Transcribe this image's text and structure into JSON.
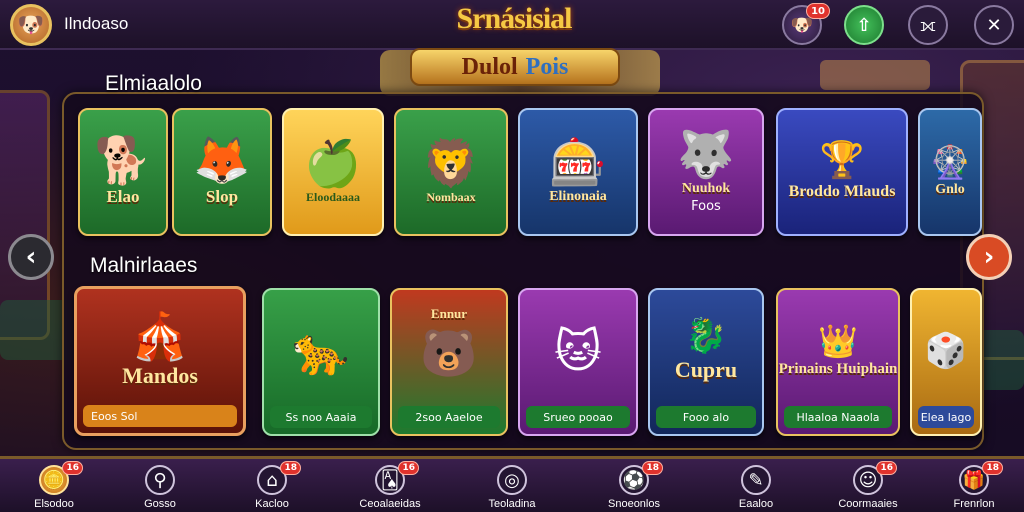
{
  "header": {
    "username": "Ilndoaso",
    "logo": "Srnásisial",
    "banner_left": "Dulol",
    "banner_right": "Pois",
    "profile_badge": "10",
    "colors": {
      "accent": "#f6c944",
      "badge": "#e0322d"
    }
  },
  "sections": [
    {
      "title": "Elmiaalolo",
      "games": [
        {
          "title": "Elao",
          "emblem": "🐕",
          "bg": "#2f8a3a"
        },
        {
          "title": "Slop",
          "emblem": "🦊",
          "bg": "#2e7d35"
        },
        {
          "title": "Eloodaaaa",
          "emblem": "🍏",
          "bg": "#f0b531"
        },
        {
          "title": "Nombaax",
          "emblem": "🦁",
          "bg": "#2b8a40"
        },
        {
          "title": "Elinonaia",
          "emblem": "🎰",
          "bg": "#1e4a86"
        },
        {
          "title": "Nuuhok",
          "emblem": "🐺",
          "bg": "#7a2a8a",
          "foot": "Foos"
        },
        {
          "title": "Broddo Mlauds",
          "emblem": "🏆",
          "bg": "#2a3a9a"
        },
        {
          "title": "Gnlo",
          "emblem": "🎡",
          "bg": "#28608a"
        }
      ]
    },
    {
      "title": "Malnirlaaes",
      "games": [
        {
          "title": "Mandos",
          "emblem": "🎪",
          "bg": "#8a2a1a",
          "foot": "Eoos Sol"
        },
        {
          "title": "",
          "emblem": "🐆",
          "bg": "#2e7d35",
          "foot": "Ss noo Aaaia"
        },
        {
          "title": "Ennur",
          "emblem": "🐻",
          "bg": "#1e7a35",
          "foot": "2soo Aaeloe"
        },
        {
          "title": "",
          "emblem": "🐱",
          "bg": "#6a2a8a",
          "foot": "Srueo pooao"
        },
        {
          "title": "Cupru",
          "emblem": "🐉",
          "bg": "#1a3f7a",
          "foot": "Fooo alo"
        },
        {
          "title": "Prinains Huiphain",
          "emblem": "👑",
          "bg": "#7a2a8a",
          "foot": "Hlaaloa Naaola"
        },
        {
          "title": "",
          "emblem": "🎲",
          "bg": "#c9932a",
          "foot": "Elea lago"
        }
      ]
    }
  ],
  "nav": {
    "arrow_left": "‹",
    "arrow_right": "›",
    "items": [
      {
        "label": "Elsodoo",
        "icon": "🪙",
        "badge": "16",
        "active": true
      },
      {
        "label": "Gosso",
        "icon": "⚲",
        "badge": ""
      },
      {
        "label": "Kacloo",
        "icon": "⌂",
        "badge": "18"
      },
      {
        "label": "Ceoalaeidas",
        "icon": "🂡",
        "badge": "16"
      },
      {
        "label": "Teoladina",
        "icon": "◎",
        "badge": ""
      },
      {
        "label": "Snoeonlos",
        "icon": "⚽",
        "badge": "18"
      },
      {
        "label": "Eaaloo",
        "icon": "✎",
        "badge": ""
      },
      {
        "label": "Coormaaies",
        "icon": "☺",
        "badge": "16"
      },
      {
        "label": "Frenrlon",
        "icon": "🎁",
        "badge": "18"
      }
    ]
  }
}
